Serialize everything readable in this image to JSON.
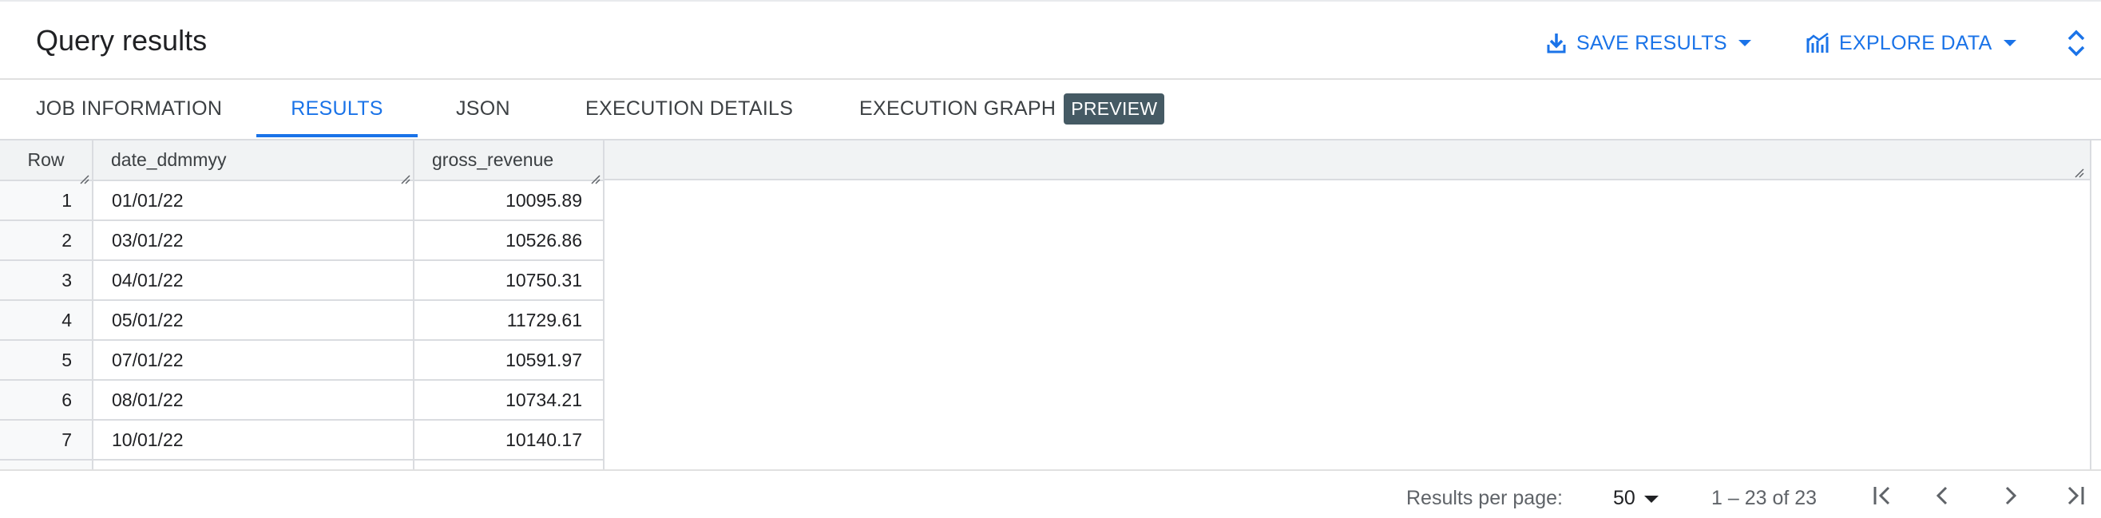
{
  "header": {
    "title": "Query results",
    "save_results": "SAVE RESULTS",
    "explore_data": "EXPLORE DATA"
  },
  "tabs": [
    {
      "label": "JOB INFORMATION",
      "active": false
    },
    {
      "label": "RESULTS",
      "active": true
    },
    {
      "label": "JSON",
      "active": false
    },
    {
      "label": "EXECUTION DETAILS",
      "active": false
    },
    {
      "label": "EXECUTION GRAPH",
      "active": false,
      "badge": "PREVIEW"
    }
  ],
  "table": {
    "columns": [
      "Row",
      "date_ddmmyy",
      "gross_revenue"
    ],
    "rows": [
      {
        "row": "1",
        "date_ddmmyy": "01/01/22",
        "gross_revenue": "10095.89"
      },
      {
        "row": "2",
        "date_ddmmyy": "03/01/22",
        "gross_revenue": "10526.86"
      },
      {
        "row": "3",
        "date_ddmmyy": "04/01/22",
        "gross_revenue": "10750.31"
      },
      {
        "row": "4",
        "date_ddmmyy": "05/01/22",
        "gross_revenue": "11729.61"
      },
      {
        "row": "5",
        "date_ddmmyy": "07/01/22",
        "gross_revenue": "10591.97"
      },
      {
        "row": "6",
        "date_ddmmyy": "08/01/22",
        "gross_revenue": "10734.21"
      },
      {
        "row": "7",
        "date_ddmmyy": "10/01/22",
        "gross_revenue": "10140.17"
      }
    ]
  },
  "pagination": {
    "results_per_page_label": "Results per page:",
    "results_per_page_value": "50",
    "range_text": "1 – 23 of 23"
  },
  "colors": {
    "accent": "#1a73e8",
    "badge_bg": "#455a64",
    "header_bg": "#f1f3f4",
    "border": "#dadce0"
  },
  "icons": [
    "download-icon",
    "caret-down-icon",
    "explore-chart-icon",
    "expand-collapse-icon",
    "first-page-icon",
    "prev-page-icon",
    "next-page-icon",
    "last-page-icon",
    "column-resize-icon"
  ]
}
